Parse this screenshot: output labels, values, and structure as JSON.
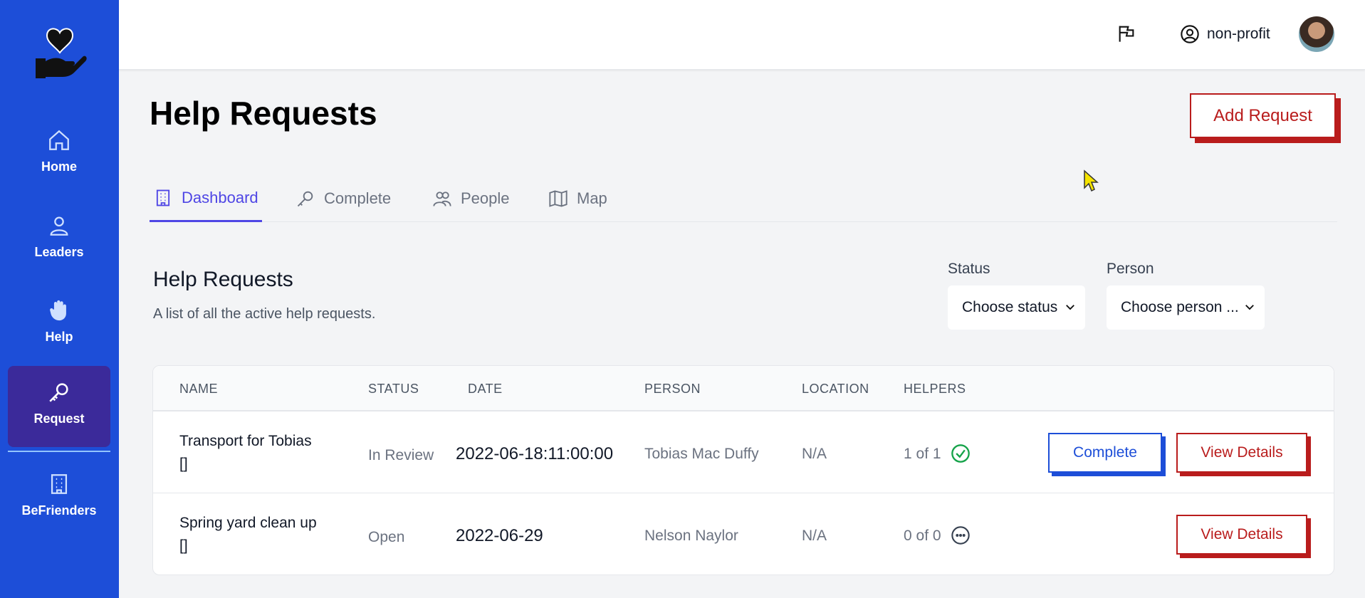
{
  "sidebar": {
    "logo": "heart-in-hand-logo",
    "items": [
      {
        "label": "Home",
        "icon": "home-icon"
      },
      {
        "label": "Leaders",
        "icon": "user-icon"
      },
      {
        "label": "Help",
        "icon": "hand-icon"
      },
      {
        "label": "Request",
        "icon": "key-icon",
        "active": true
      },
      {
        "label": "BeFrienders",
        "icon": "building-icon"
      }
    ]
  },
  "topbar": {
    "account_label": "non-profit",
    "flag_icon": "flag-icon",
    "account_icon": "user-circle-icon"
  },
  "page": {
    "title": "Help Requests",
    "add_button": "Add Request"
  },
  "tabs": [
    {
      "label": "Dashboard",
      "icon": "building-icon",
      "active": true
    },
    {
      "label": "Complete",
      "icon": "key-icon"
    },
    {
      "label": "People",
      "icon": "users-icon"
    },
    {
      "label": "Map",
      "icon": "map-icon"
    }
  ],
  "section": {
    "title": "Help Requests",
    "description": "A list of all the active help requests."
  },
  "filters": {
    "status_label": "Status",
    "status_value": "Choose status",
    "person_label": "Person",
    "person_value": "Choose person ..."
  },
  "table": {
    "headers": [
      "NAME",
      "STATUS",
      "DATE",
      "PERSON",
      "LOCATION",
      "HELPERS"
    ],
    "rows": [
      {
        "name": "Transport for Tobias",
        "tags": "[]",
        "status": "In Review",
        "date": "2022-06-18:11:00:00",
        "person": "Tobias Mac Duffy",
        "location": "N/A",
        "helpers": "1 of 1",
        "helpers_icon": "check-circle-icon",
        "complete_label": "Complete",
        "view_label": "View Details"
      },
      {
        "name": "Spring yard clean up",
        "tags": "[]",
        "status": "Open",
        "date": "2022-06-29",
        "person": "Nelson Naylor",
        "location": "N/A",
        "helpers": "0 of 0",
        "helpers_icon": "dots-circle-icon",
        "view_label": "View Details"
      }
    ]
  },
  "colors": {
    "sidebar": "#1d4ed8",
    "sidebar_active": "#3b2a9a",
    "accent": "#4f46e5",
    "danger": "#b91c1c",
    "success": "#16a34a"
  }
}
